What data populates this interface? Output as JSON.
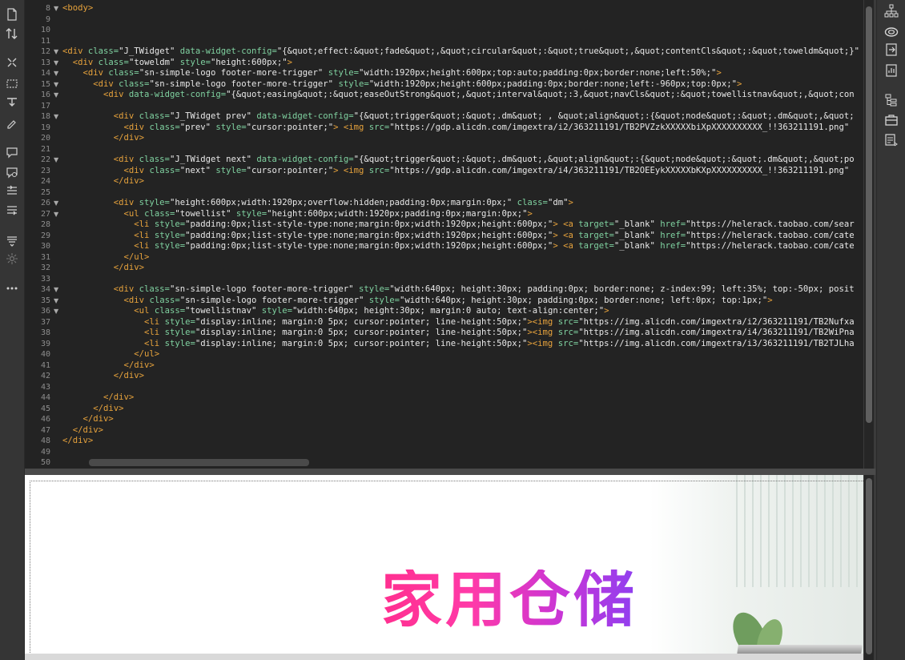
{
  "left_toolbar": {
    "icons": [
      "file-icon",
      "sort-icon",
      "expand-icon",
      "select-icon",
      "wand-icon",
      "brush-icon",
      "comment-icon",
      "comment-alt-icon",
      "indent-icon",
      "outdent-icon",
      "format-icon",
      "sun-icon",
      "more-icon"
    ]
  },
  "right_toolbar": {
    "icons": [
      "sitemap-icon",
      "cloud-icon",
      "export-icon",
      "document-icon",
      "layers-icon",
      "briefcase-icon",
      "snippets-icon"
    ]
  },
  "code": {
    "lines": [
      {
        "n": "8",
        "fold": true,
        "segs": [
          {
            "t": "<body>",
            "c": "tag"
          }
        ]
      },
      {
        "n": "9",
        "fold": false,
        "segs": []
      },
      {
        "n": "10",
        "fold": false,
        "segs": []
      },
      {
        "n": "11",
        "fold": false,
        "segs": []
      },
      {
        "n": "12",
        "fold": true,
        "segs": [
          {
            "t": "<div ",
            "c": "tag"
          },
          {
            "t": "class=",
            "c": "attr"
          },
          {
            "t": "\"J_TWidget\" ",
            "c": "val"
          },
          {
            "t": "data-widget-config=",
            "c": "attr"
          },
          {
            "t": "\"{&quot;effect:&quot;fade&quot;,&quot;circular&quot;:&quot;true&quot;,&quot;contentCls&quot;:&quot;toweldm&quot;}\"",
            "c": "val"
          }
        ]
      },
      {
        "n": "13",
        "fold": true,
        "segs": [
          {
            "t": "  <div ",
            "c": "tag"
          },
          {
            "t": "class=",
            "c": "attr"
          },
          {
            "t": "\"toweldm\" ",
            "c": "val"
          },
          {
            "t": "style=",
            "c": "attr"
          },
          {
            "t": "\"height:600px;\"",
            "c": "val"
          },
          {
            "t": ">",
            "c": "tag"
          }
        ]
      },
      {
        "n": "14",
        "fold": true,
        "segs": [
          {
            "t": "    <div ",
            "c": "tag"
          },
          {
            "t": "class=",
            "c": "attr"
          },
          {
            "t": "\"sn-simple-logo footer-more-trigger\" ",
            "c": "val"
          },
          {
            "t": "style=",
            "c": "attr"
          },
          {
            "t": "\"width:1920px;height:600px;top:auto;padding:0px;border:none;left:50%;\"",
            "c": "val"
          },
          {
            "t": ">",
            "c": "tag"
          }
        ]
      },
      {
        "n": "15",
        "fold": true,
        "segs": [
          {
            "t": "      <div ",
            "c": "tag"
          },
          {
            "t": "class=",
            "c": "attr"
          },
          {
            "t": "\"sn-simple-logo footer-more-trigger\" ",
            "c": "val"
          },
          {
            "t": "style=",
            "c": "attr"
          },
          {
            "t": "\"width:1920px;height:600px;padding:0px;border:none;left:-960px;top:0px;\"",
            "c": "val"
          },
          {
            "t": ">",
            "c": "tag"
          }
        ]
      },
      {
        "n": "16",
        "fold": true,
        "segs": [
          {
            "t": "        <div ",
            "c": "tag"
          },
          {
            "t": "data-widget-config=",
            "c": "attr"
          },
          {
            "t": "\"{&quot;easing&quot;:&quot;easeOutStrong&quot;,&quot;interval&quot;:3,&quot;navCls&quot;:&quot;towellistnav&quot;,&quot;con",
            "c": "val"
          }
        ]
      },
      {
        "n": "17",
        "fold": false,
        "segs": []
      },
      {
        "n": "18",
        "fold": true,
        "segs": [
          {
            "t": "          <div ",
            "c": "tag"
          },
          {
            "t": "class=",
            "c": "attr"
          },
          {
            "t": "\"J_TWidget prev\" ",
            "c": "val"
          },
          {
            "t": "data-widget-config=",
            "c": "attr"
          },
          {
            "t": "\"{&quot;trigger&quot;:&quot;.dm&quot; , &quot;align&quot;:{&quot;node&quot;:&quot;.dm&quot;,&quot;",
            "c": "val"
          }
        ]
      },
      {
        "n": "19",
        "fold": false,
        "segs": [
          {
            "t": "            <div ",
            "c": "tag"
          },
          {
            "t": "class=",
            "c": "attr"
          },
          {
            "t": "\"prev\" ",
            "c": "val"
          },
          {
            "t": "style=",
            "c": "attr"
          },
          {
            "t": "\"cursor:pointer;\"",
            "c": "val"
          },
          {
            "t": "> <img ",
            "c": "tag"
          },
          {
            "t": "src=",
            "c": "attr"
          },
          {
            "t": "\"https://gdp.alicdn.com/imgextra/i2/363211191/TB2PVZzkXXXXXbiXpXXXXXXXXXX_!!363211191.png\"",
            "c": "val"
          }
        ]
      },
      {
        "n": "20",
        "fold": false,
        "segs": [
          {
            "t": "          </div>",
            "c": "tag"
          }
        ]
      },
      {
        "n": "21",
        "fold": false,
        "segs": []
      },
      {
        "n": "22",
        "fold": true,
        "segs": [
          {
            "t": "          <div ",
            "c": "tag"
          },
          {
            "t": "class=",
            "c": "attr"
          },
          {
            "t": "\"J_TWidget next\" ",
            "c": "val"
          },
          {
            "t": "data-widget-config=",
            "c": "attr"
          },
          {
            "t": "\"{&quot;trigger&quot;:&quot;.dm&quot;,&quot;align&quot;:{&quot;node&quot;:&quot;.dm&quot;,&quot;po",
            "c": "val"
          }
        ]
      },
      {
        "n": "23",
        "fold": false,
        "segs": [
          {
            "t": "            <div ",
            "c": "tag"
          },
          {
            "t": "class=",
            "c": "attr"
          },
          {
            "t": "\"next\" ",
            "c": "val"
          },
          {
            "t": "style=",
            "c": "attr"
          },
          {
            "t": "\"cursor:pointer;\"",
            "c": "val"
          },
          {
            "t": "> <img ",
            "c": "tag"
          },
          {
            "t": "src=",
            "c": "attr"
          },
          {
            "t": "\"https://gdp.alicdn.com/imgextra/i4/363211191/TB2OEEykXXXXXbKXpXXXXXXXXXX_!!363211191.png\"",
            "c": "val"
          }
        ]
      },
      {
        "n": "24",
        "fold": false,
        "segs": [
          {
            "t": "          </div>",
            "c": "tag"
          }
        ]
      },
      {
        "n": "25",
        "fold": false,
        "segs": []
      },
      {
        "n": "26",
        "fold": true,
        "segs": [
          {
            "t": "          <div ",
            "c": "tag"
          },
          {
            "t": "style=",
            "c": "attr"
          },
          {
            "t": "\"height:600px;width:1920px;overflow:hidden;padding:0px;margin:0px;\" ",
            "c": "val"
          },
          {
            "t": "class=",
            "c": "attr"
          },
          {
            "t": "\"dm\"",
            "c": "val"
          },
          {
            "t": ">",
            "c": "tag"
          }
        ]
      },
      {
        "n": "27",
        "fold": true,
        "segs": [
          {
            "t": "            <ul ",
            "c": "tag"
          },
          {
            "t": "class=",
            "c": "attr"
          },
          {
            "t": "\"towellist\" ",
            "c": "val"
          },
          {
            "t": "style=",
            "c": "attr"
          },
          {
            "t": "\"height:600px;width:1920px;padding:0px;margin:0px;\"",
            "c": "val"
          },
          {
            "t": ">",
            "c": "tag"
          }
        ]
      },
      {
        "n": "28",
        "fold": false,
        "segs": [
          {
            "t": "              <li ",
            "c": "tag"
          },
          {
            "t": "style=",
            "c": "attr"
          },
          {
            "t": "\"padding:0px;list-style-type:none;margin:0px;width:1920px;height:600px;\"",
            "c": "val"
          },
          {
            "t": "> <a ",
            "c": "tag"
          },
          {
            "t": "target=",
            "c": "attr"
          },
          {
            "t": "\"_blank\" ",
            "c": "val"
          },
          {
            "t": "href=",
            "c": "attr"
          },
          {
            "t": "\"https://helerack.taobao.com/sear",
            "c": "val"
          }
        ]
      },
      {
        "n": "29",
        "fold": false,
        "segs": [
          {
            "t": "              <li ",
            "c": "tag"
          },
          {
            "t": "style=",
            "c": "attr"
          },
          {
            "t": "\"padding:0px;list-style-type:none;margin:0px;width:1920px;height:600px;\"",
            "c": "val"
          },
          {
            "t": "> <a ",
            "c": "tag"
          },
          {
            "t": "target=",
            "c": "attr"
          },
          {
            "t": "\"_blank\" ",
            "c": "val"
          },
          {
            "t": "href=",
            "c": "attr"
          },
          {
            "t": "\"https://helerack.taobao.com/cate",
            "c": "val"
          }
        ]
      },
      {
        "n": "30",
        "fold": false,
        "segs": [
          {
            "t": "              <li ",
            "c": "tag"
          },
          {
            "t": "style=",
            "c": "attr"
          },
          {
            "t": "\"padding:0px;list-style-type:none;margin:0px;width:1920px;height:600px;\"",
            "c": "val"
          },
          {
            "t": "> <a ",
            "c": "tag"
          },
          {
            "t": "target=",
            "c": "attr"
          },
          {
            "t": "\"_blank\" ",
            "c": "val"
          },
          {
            "t": "href=",
            "c": "attr"
          },
          {
            "t": "\"https://helerack.taobao.com/cate",
            "c": "val"
          }
        ]
      },
      {
        "n": "31",
        "fold": false,
        "segs": [
          {
            "t": "            </ul>",
            "c": "tag"
          }
        ]
      },
      {
        "n": "32",
        "fold": false,
        "segs": [
          {
            "t": "          </div>",
            "c": "tag"
          }
        ]
      },
      {
        "n": "33",
        "fold": false,
        "segs": []
      },
      {
        "n": "34",
        "fold": true,
        "segs": [
          {
            "t": "          <div ",
            "c": "tag"
          },
          {
            "t": "class=",
            "c": "attr"
          },
          {
            "t": "\"sn-simple-logo footer-more-trigger\" ",
            "c": "val"
          },
          {
            "t": "style=",
            "c": "attr"
          },
          {
            "t": "\"width:640px; height:30px; padding:0px; border:none; z-index:99; left:35%; top:-50px; posit",
            "c": "val"
          }
        ]
      },
      {
        "n": "35",
        "fold": true,
        "segs": [
          {
            "t": "            <div ",
            "c": "tag"
          },
          {
            "t": "class=",
            "c": "attr"
          },
          {
            "t": "\"sn-simple-logo footer-more-trigger\" ",
            "c": "val"
          },
          {
            "t": "style=",
            "c": "attr"
          },
          {
            "t": "\"width:640px; height:30px; padding:0px; border:none; left:0px; top:1px;\"",
            "c": "val"
          },
          {
            "t": ">",
            "c": "tag"
          }
        ]
      },
      {
        "n": "36",
        "fold": true,
        "segs": [
          {
            "t": "              <ul ",
            "c": "tag"
          },
          {
            "t": "class=",
            "c": "attr"
          },
          {
            "t": "\"towellistnav\" ",
            "c": "val"
          },
          {
            "t": "style=",
            "c": "attr"
          },
          {
            "t": "\"width:640px; height:30px; margin:0 auto; text-align:center;\"",
            "c": "val"
          },
          {
            "t": ">",
            "c": "tag"
          }
        ]
      },
      {
        "n": "37",
        "fold": false,
        "segs": [
          {
            "t": "                <li ",
            "c": "tag"
          },
          {
            "t": "style=",
            "c": "attr"
          },
          {
            "t": "\"display:inline; margin:0 5px; cursor:pointer; line-height:50px;\"",
            "c": "val"
          },
          {
            "t": "><img ",
            "c": "tag"
          },
          {
            "t": "src=",
            "c": "attr"
          },
          {
            "t": "\"https://img.alicdn.com/imgextra/i2/363211191/TB2Nufxa",
            "c": "val"
          }
        ]
      },
      {
        "n": "38",
        "fold": false,
        "segs": [
          {
            "t": "                <li ",
            "c": "tag"
          },
          {
            "t": "style=",
            "c": "attr"
          },
          {
            "t": "\"display:inline; margin:0 5px; cursor:pointer; line-height:50px;\"",
            "c": "val"
          },
          {
            "t": "><img ",
            "c": "tag"
          },
          {
            "t": "src=",
            "c": "attr"
          },
          {
            "t": "\"https://img.alicdn.com/imgextra/i4/363211191/TB2WiPna",
            "c": "val"
          }
        ]
      },
      {
        "n": "39",
        "fold": false,
        "segs": [
          {
            "t": "                <li ",
            "c": "tag"
          },
          {
            "t": "style=",
            "c": "attr"
          },
          {
            "t": "\"display:inline; margin:0 5px; cursor:pointer; line-height:50px;\"",
            "c": "val"
          },
          {
            "t": "><img ",
            "c": "tag"
          },
          {
            "t": "src=",
            "c": "attr"
          },
          {
            "t": "\"https://img.alicdn.com/imgextra/i3/363211191/TB2TJLha",
            "c": "val"
          }
        ]
      },
      {
        "n": "40",
        "fold": false,
        "segs": [
          {
            "t": "              </ul>",
            "c": "tag"
          }
        ]
      },
      {
        "n": "41",
        "fold": false,
        "segs": [
          {
            "t": "            </div>",
            "c": "tag"
          }
        ]
      },
      {
        "n": "42",
        "fold": false,
        "segs": [
          {
            "t": "          </div>",
            "c": "tag"
          }
        ]
      },
      {
        "n": "43",
        "fold": false,
        "segs": []
      },
      {
        "n": "44",
        "fold": false,
        "segs": [
          {
            "t": "        </div>",
            "c": "tag"
          }
        ]
      },
      {
        "n": "45",
        "fold": false,
        "segs": [
          {
            "t": "      </div>",
            "c": "tag"
          }
        ]
      },
      {
        "n": "46",
        "fold": false,
        "segs": [
          {
            "t": "    </div>",
            "c": "tag"
          }
        ]
      },
      {
        "n": "47",
        "fold": false,
        "segs": [
          {
            "t": "  </div>",
            "c": "tag"
          }
        ]
      },
      {
        "n": "48",
        "fold": false,
        "segs": [
          {
            "t": "</div>",
            "c": "tag"
          }
        ]
      },
      {
        "n": "49",
        "fold": false,
        "segs": []
      },
      {
        "n": "50",
        "fold": false,
        "segs": []
      }
    ]
  },
  "design": {
    "banner_text": "家用仓储"
  },
  "colors": {
    "tag": "#e6a23c",
    "attr": "#7fd1a0",
    "value": "#e8e8e8",
    "gutter_number": "#8d8d8d",
    "banner_pink": "#ff2f8f",
    "banner_purple": "#8e3ff0"
  }
}
